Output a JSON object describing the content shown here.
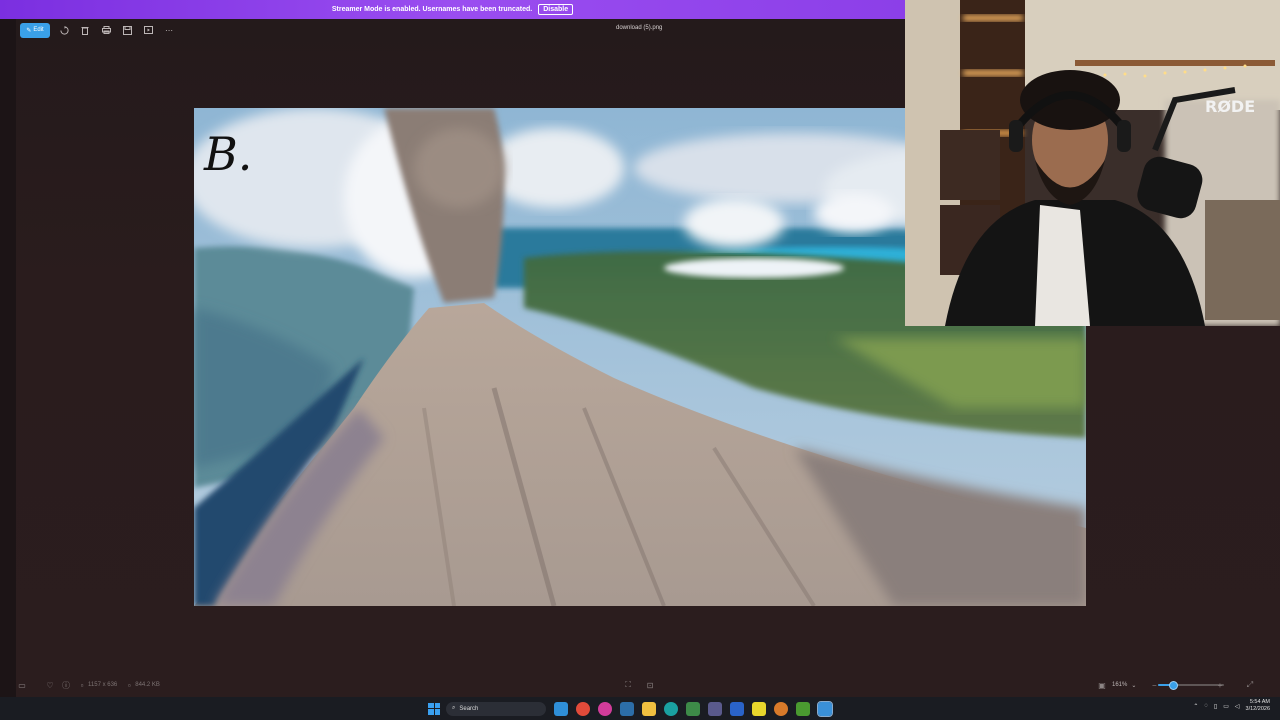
{
  "banner": {
    "message": "Streamer Mode is enabled. Usernames have been truncated.",
    "button": "Disable"
  },
  "toolbar": {
    "edit_label": "Edit",
    "icons": [
      "rotate-icon",
      "delete-icon",
      "print-icon",
      "save-icon",
      "slideshow-icon",
      "more-icon"
    ],
    "filename": "download (5).png"
  },
  "painting": {
    "signature": "B."
  },
  "statusbar": {
    "dimensions": "1157 x 636",
    "filesize": "844.2 KB",
    "zoom": "161%",
    "zoom_slider_fraction": 0.22
  },
  "taskbar": {
    "search_placeholder": "Search",
    "time": "5:54 AM",
    "date": "3/12/2026"
  },
  "colors": {
    "banner": "#8a3ee8",
    "accent": "#3aa0e8",
    "viewer_bg": "#2a1c1d"
  }
}
